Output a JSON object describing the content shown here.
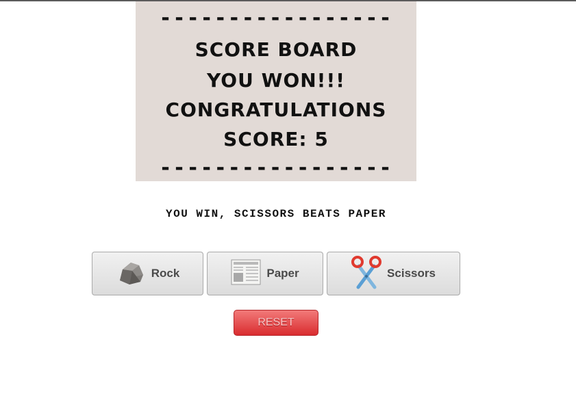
{
  "scoreboard": {
    "dashes": "-----------------",
    "title": "SCORE BOARD",
    "result": "YOU WON!!!",
    "congrats": "CONGRATULATIONS",
    "score": "SCORE: 5"
  },
  "round_result": "YOU WIN, SCISSORS BEATS PAPER",
  "choices": {
    "rock": {
      "label": "Rock",
      "icon": "rock-icon"
    },
    "paper": {
      "label": "Paper",
      "icon": "newspaper-icon"
    },
    "scissors": {
      "label": "Scissors",
      "icon": "scissors-icon"
    }
  },
  "reset_label": "RESET",
  "colors": {
    "scoreboard_bg": "#e2dad6",
    "reset_red": "#d92c2f",
    "button_gray": "#dcdcdc"
  }
}
